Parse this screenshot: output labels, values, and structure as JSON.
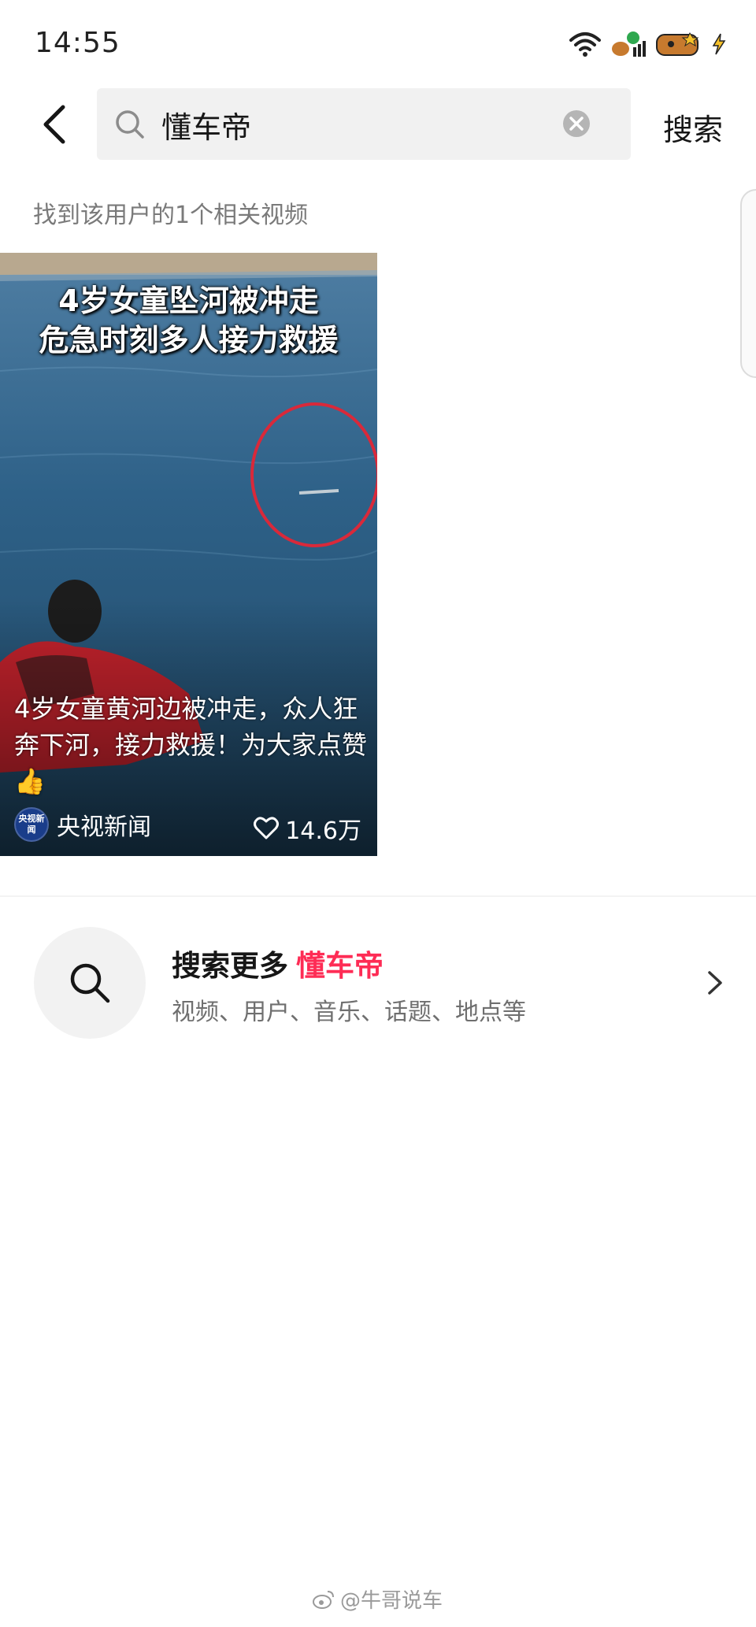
{
  "status_bar": {
    "time": "14:55",
    "icons": [
      "wifi-icon",
      "signal-icon",
      "battery-icon",
      "charging-icon"
    ]
  },
  "search": {
    "query": "懂车帝",
    "submit_label": "搜索"
  },
  "results": {
    "count_text": "找到该用户的1个相关视频"
  },
  "video": {
    "overlay_title_line1": "4岁女童坠河被冲走",
    "overlay_title_line2": "危急时刻多人接力救援",
    "caption": "4岁女童黄河边被冲走，众人狂奔下河，接力救援！为大家点赞👍",
    "author_avatar_text": "央视新闻",
    "author": "央视新闻",
    "likes": "14.6万"
  },
  "more": {
    "prefix": "搜索更多",
    "keyword": "懂车帝",
    "subtitle": "视频、用户、音乐、话题、地点等"
  },
  "watermark": {
    "text": "@牛哥说车"
  },
  "colors": {
    "accent": "#fe2c55",
    "search_bg": "#f1f1f1",
    "muted_text": "#7a7a7a"
  }
}
